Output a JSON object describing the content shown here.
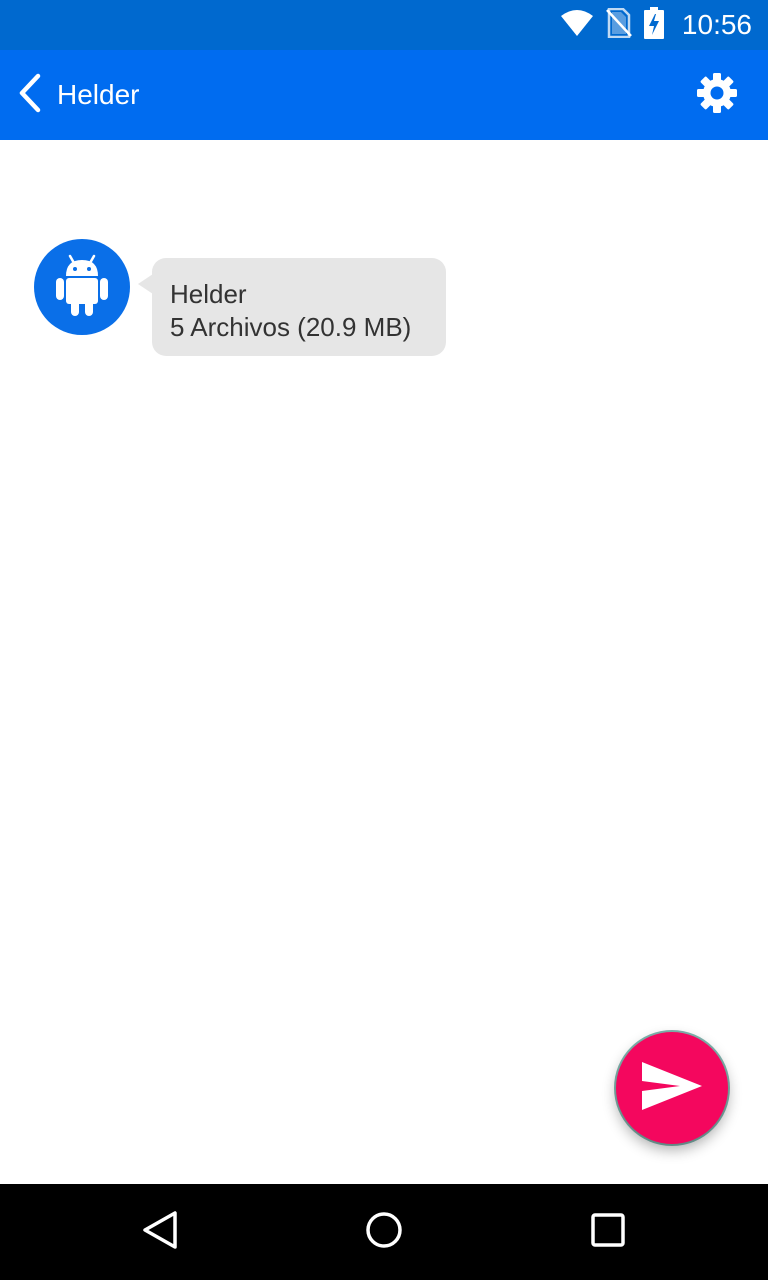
{
  "status_bar": {
    "time": "10:56",
    "icons": [
      "wifi-icon",
      "no-sim-icon",
      "battery-charging-icon"
    ]
  },
  "app_bar": {
    "title": "Helder",
    "back_icon": "chevron-left-icon",
    "settings_icon": "gear-icon"
  },
  "message": {
    "avatar_icon": "android-icon",
    "sender": "Helder",
    "summary": "5 Archivos (20.9 MB)"
  },
  "fab": {
    "icon": "send-icon",
    "color": "#f4075e"
  },
  "nav_bar": {
    "icons": [
      "back-triangle-icon",
      "home-circle-icon",
      "recents-square-icon"
    ]
  },
  "colors": {
    "status_bar": "#0069cf",
    "app_bar": "#006cf0",
    "avatar": "#0a6fe8",
    "bubble": "#e6e6e6"
  }
}
